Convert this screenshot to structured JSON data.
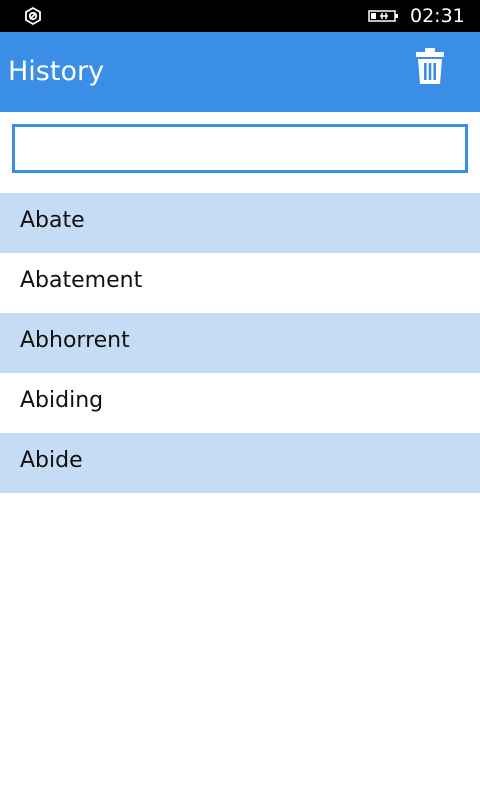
{
  "status_bar": {
    "time": "02:31",
    "left_icon": "sync-icon",
    "right_icon": "battery-charging-icon"
  },
  "header": {
    "title": "History",
    "action_icon": "trash-icon"
  },
  "search": {
    "value": "",
    "placeholder": ""
  },
  "history": {
    "items": [
      {
        "label": "Abate"
      },
      {
        "label": "Abatement"
      },
      {
        "label": "Abhorrent"
      },
      {
        "label": "Abiding"
      },
      {
        "label": "Abide"
      }
    ]
  },
  "colors": {
    "accent": "#3a8ee6",
    "row_shade": "#c4dcf4",
    "status_bar": "#000000"
  }
}
